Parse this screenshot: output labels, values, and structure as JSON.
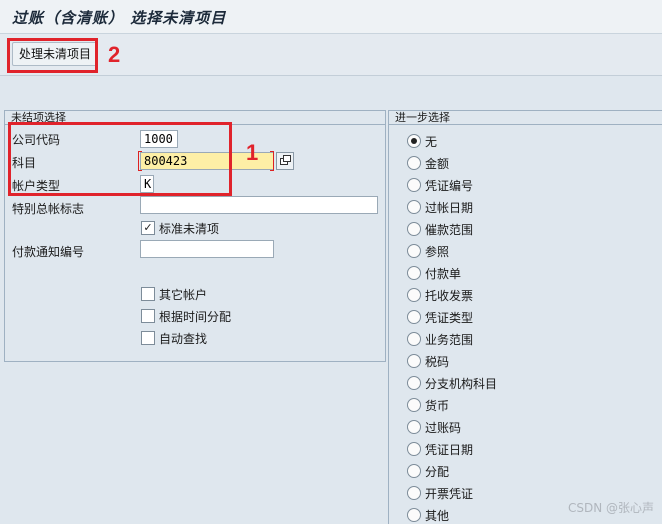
{
  "title": "过账（含清账） 选择未清项目",
  "toolbar": {
    "process_label": "处理未清项目"
  },
  "annotations": {
    "num1": "1",
    "num2": "2"
  },
  "left_group": {
    "title": "未结项选择",
    "company_code_label": "公司代码",
    "company_code_value": "1000",
    "account_label": "科目",
    "account_value": "800423",
    "account_type_label": "帐户类型",
    "account_type_value": "K",
    "special_gl_label": "特别总帐标志",
    "special_gl_value": "",
    "standard_open_label": "标准未清项",
    "standard_open_checked": "✓",
    "payment_notice_label": "付款通知编号",
    "payment_notice_value": "",
    "other_accounts_label": "其它帐户",
    "time_distribution_label": "根据时间分配",
    "auto_search_label": "自动查找"
  },
  "right_group": {
    "title": "进一步选择",
    "options": [
      "无",
      "金额",
      "凭证编号",
      "过帐日期",
      "催款范围",
      "参照",
      "付款单",
      "托收发票",
      "凭证类型",
      "业务范围",
      "税码",
      "分支机构科目",
      "货币",
      "过账码",
      "凭证日期",
      "分配",
      "开票凭证",
      "其他"
    ]
  },
  "watermark": "CSDN @张心声",
  "colors": {
    "annotation": "#e0232b",
    "required_field": "#fdefa6"
  }
}
